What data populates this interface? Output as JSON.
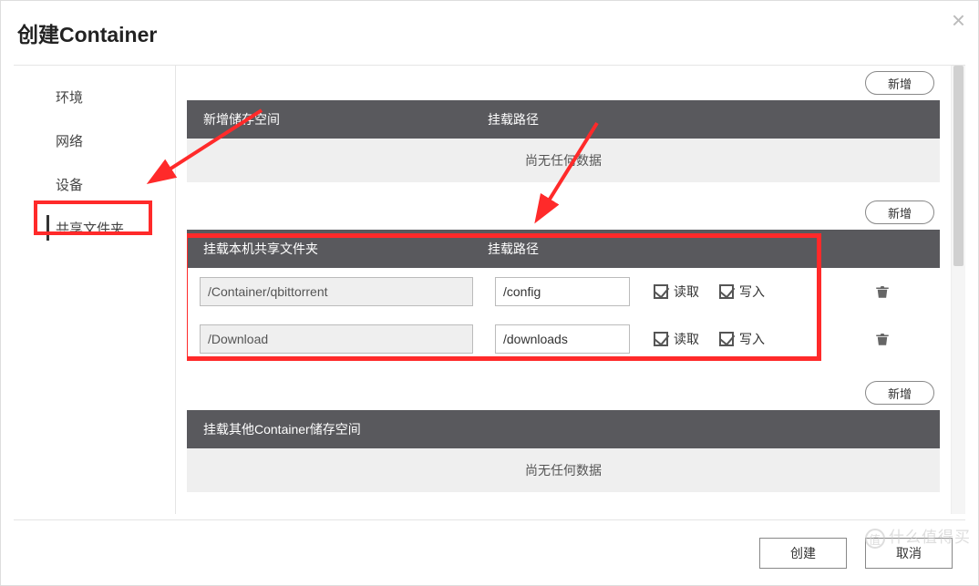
{
  "modal": {
    "title": "创建Container",
    "close_glyph": "×"
  },
  "sidebar": {
    "items": [
      {
        "label": "环境"
      },
      {
        "label": "网络"
      },
      {
        "label": "设备"
      },
      {
        "label": "共享文件夹"
      }
    ]
  },
  "buttons": {
    "add": "新增",
    "create": "创建",
    "cancel": "取消"
  },
  "section1": {
    "header_a": "新增储存空间",
    "header_b": "挂载路径",
    "empty_text": "尚无任何数据"
  },
  "section2": {
    "header_a": "挂载本机共享文件夹",
    "header_b": "挂载路径",
    "rows": [
      {
        "host": "/Container/qbittorrent",
        "mount": "/config",
        "read": true,
        "write": true
      },
      {
        "host": "/Download",
        "mount": "/downloads",
        "read": true,
        "write": true
      }
    ],
    "labels": {
      "read": "读取",
      "write": "写入"
    }
  },
  "section3": {
    "header": "挂载其他Container储存空间",
    "empty_text": "尚无任何数据"
  },
  "watermark": "什么值得买"
}
